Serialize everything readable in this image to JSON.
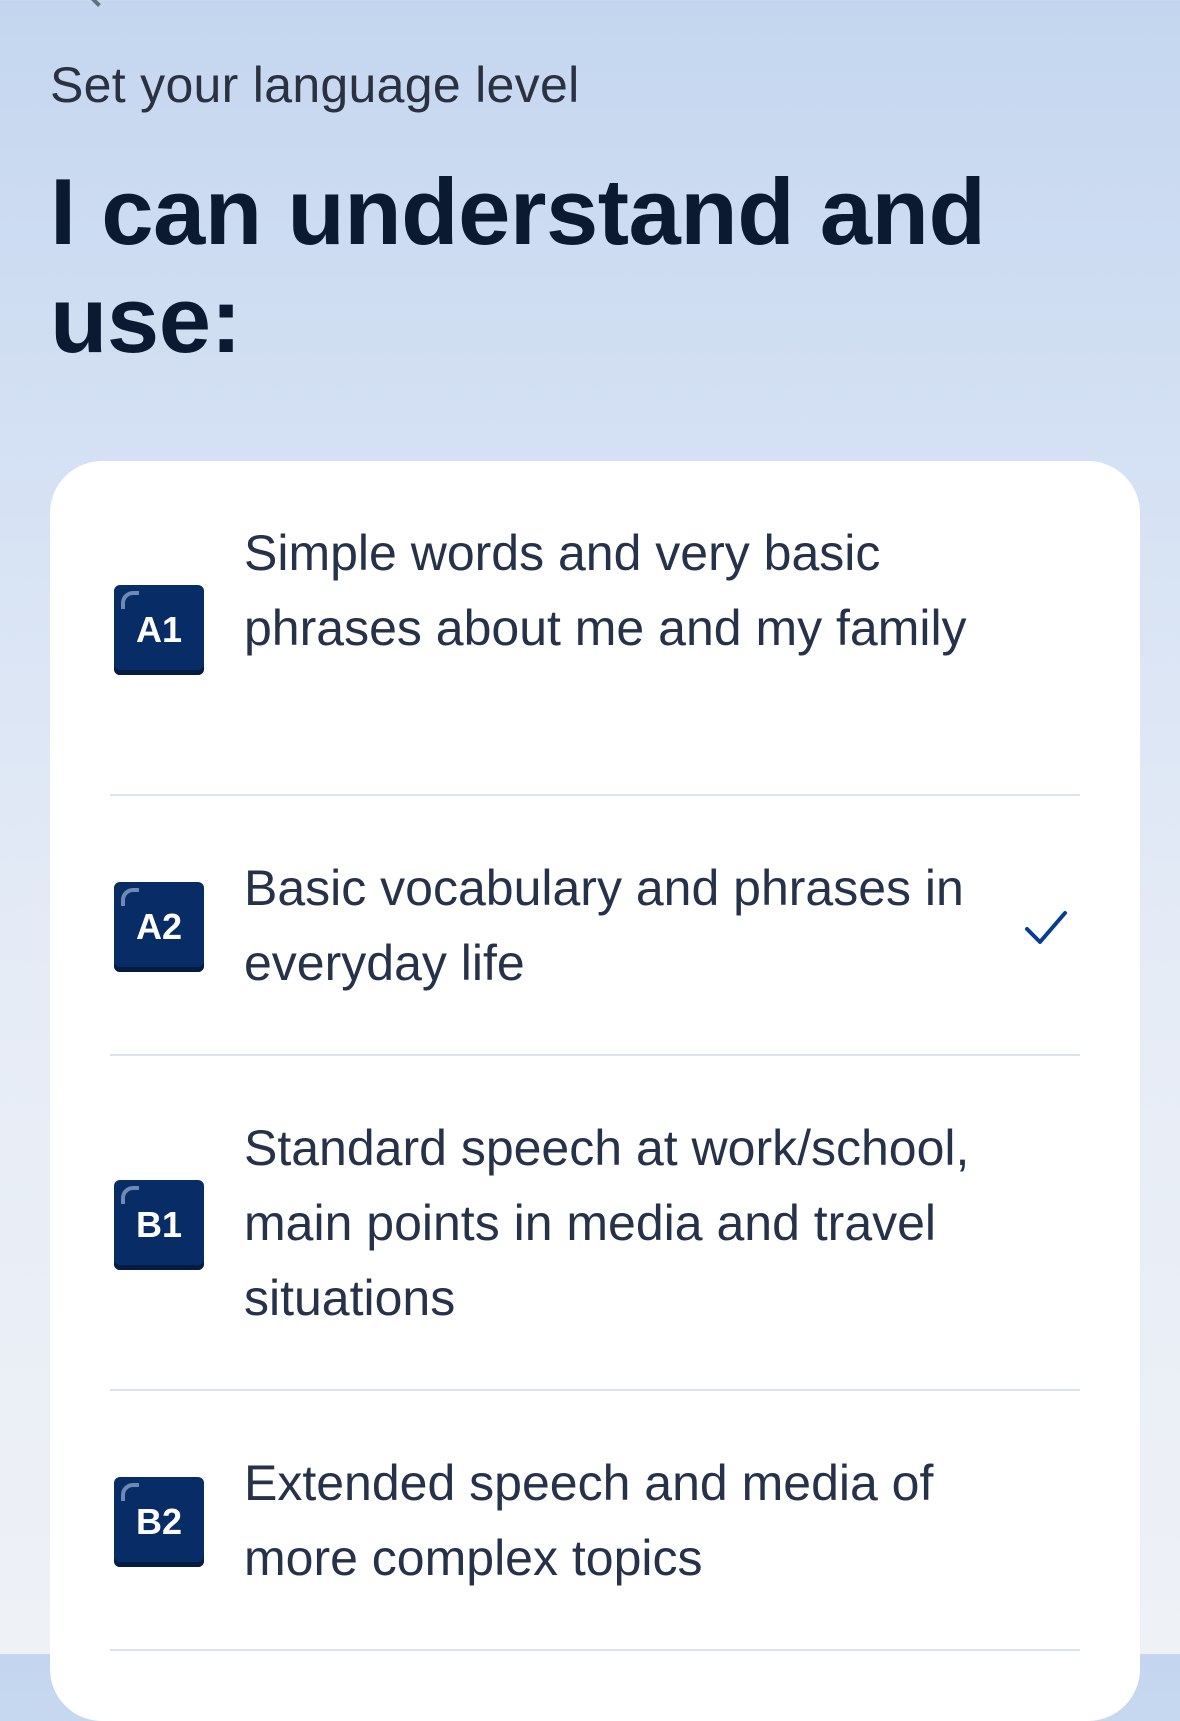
{
  "header": {
    "subtitle": "Set your language level",
    "title": "I can understand and use:"
  },
  "options": [
    {
      "level": "A1",
      "description": "Simple words and very basic phrases about me and my family",
      "selected": false
    },
    {
      "level": "A2",
      "description": "Basic vocabulary and phrases in everyday life",
      "selected": true
    },
    {
      "level": "B1",
      "description": "Standard speech at work/school, main points in media and travel situations",
      "selected": false
    },
    {
      "level": "B2",
      "description": "Extended speech and media of more complex topics",
      "selected": false
    }
  ],
  "colors": {
    "badge": "#082c66",
    "check": "#0a3d8f",
    "title": "#0c1a31"
  },
  "icons": {
    "back": "chevron-left-icon",
    "selected": "check-icon"
  }
}
